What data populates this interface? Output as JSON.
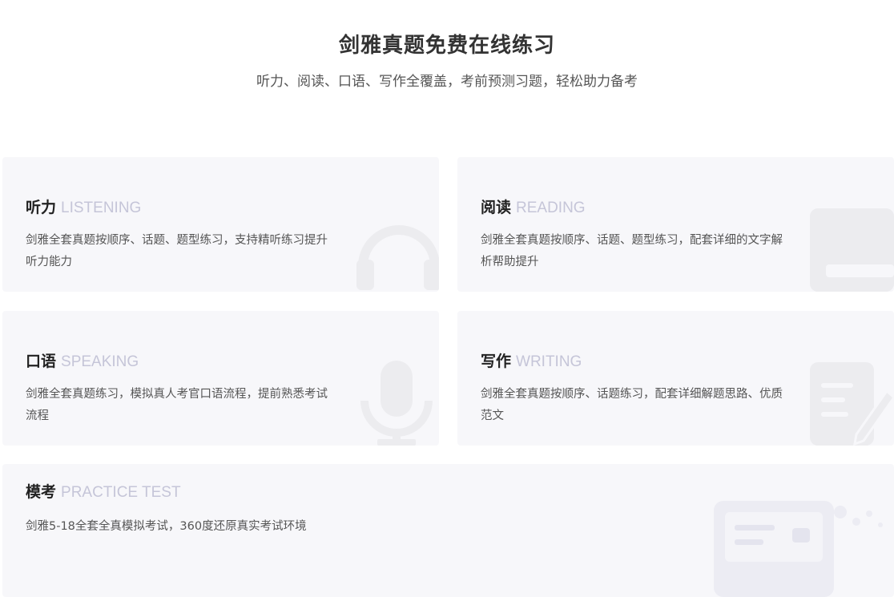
{
  "header": {
    "title": "剑雅真题免费在线练习",
    "subtitle": "听力、阅读、口语、写作全覆盖，考前预测习题，轻松助力备考"
  },
  "cards": [
    {
      "title_cn": "听力",
      "title_en": "LISTENING",
      "desc": "剑雅全套真题按顺序、话题、题型练习，支持精听练习提升听力能力",
      "icon": "headphones-icon"
    },
    {
      "title_cn": "阅读",
      "title_en": "READING",
      "desc": "剑雅全套真题按顺序、话题、题型练习，配套详细的文字解析帮助提升",
      "icon": "book-icon"
    },
    {
      "title_cn": "口语",
      "title_en": "SPEAKING",
      "desc": "剑雅全套真题练习，模拟真人考官口语流程，提前熟悉考试流程",
      "icon": "microphone-icon"
    },
    {
      "title_cn": "写作",
      "title_en": "WRITING",
      "desc": "剑雅全套真题按顺序、话题练习，配套详细解题思路、优质范文",
      "icon": "pencil-paper-icon"
    },
    {
      "title_cn": "模考",
      "title_en": "PRACTICE TEST",
      "desc": "剑雅5-18全套全真模拟考试，360度还原真实考试环境",
      "icon": "monitor-icon"
    }
  ],
  "colors": {
    "card_bg": "#f7f7fa",
    "accent_en": "#c5c5d8",
    "deco": "#ececef"
  }
}
